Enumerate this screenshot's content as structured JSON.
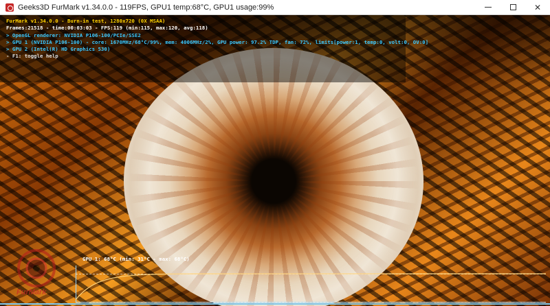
{
  "window": {
    "title": "Geeks3D FurMark v1.34.0.0 - 119FPS, GPU1 temp:68°C, GPU1 usage:99%"
  },
  "hud": {
    "line1": "FurMark v1.34.0.0 - Burn-in test, 1280x720 (0X MSAA)",
    "line2": "Frames:21518 - time:00:03:03 - FPS:119 (min:115, max:120, avg:118)",
    "line3": "> OpenGL renderer: NVIDIA P106-100/PCIe/SSE2",
    "line4": "> GPU 1 (NVIDIA P106-100) - core: 1670MHz/68°C/99%, mem: 4006MHz/2%, GPU power: 97.2% TDP, fan: 72%, limits[power:1, temp:0, volt:0, OV:0]",
    "line5": "> GPU 2 (Intel(R) HD Graphics 530)",
    "line6": "- F1: toggle help"
  },
  "graph": {
    "label": "GPU 1: 68°C (min: 31°C - max: 68°C)",
    "min_temp_c": 31,
    "max_temp_c": 68,
    "current_temp_c": 68
  },
  "logo": {
    "text": "FurMark"
  },
  "colors": {
    "hud_title": "#ffd200",
    "hud_info": "#3cc8ff",
    "graph_line": "#ffd27a"
  }
}
